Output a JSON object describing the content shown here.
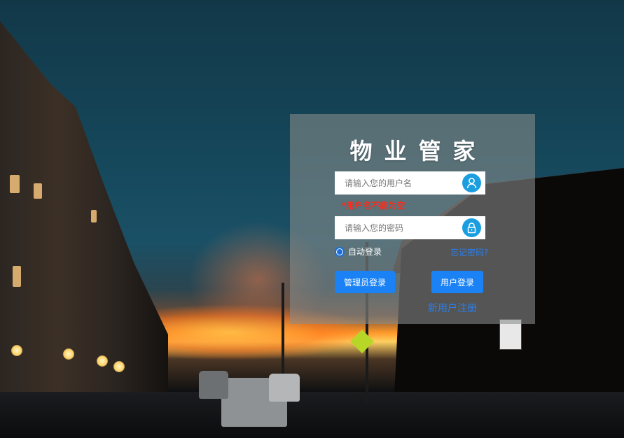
{
  "app": {
    "title": "物业管家"
  },
  "login": {
    "username_placeholder": "请输入您的用户名",
    "username_value": "",
    "username_error": "*用户名不能为空",
    "password_placeholder": "请输入您的密码",
    "password_value": "",
    "remember_label": "自动登录",
    "remember_checked": true,
    "forgot_label": "忘记密码?",
    "admin_login_label": "管理员登录",
    "user_login_label": "用户登录",
    "register_label": "新用户注册"
  },
  "icons": {
    "username": "user-icon",
    "password": "lock-icon"
  },
  "colors": {
    "accent": "#1a82f5",
    "icon_bg": "#1a9ee0",
    "error": "#ff2a1a",
    "link": "#2a7ff0"
  }
}
